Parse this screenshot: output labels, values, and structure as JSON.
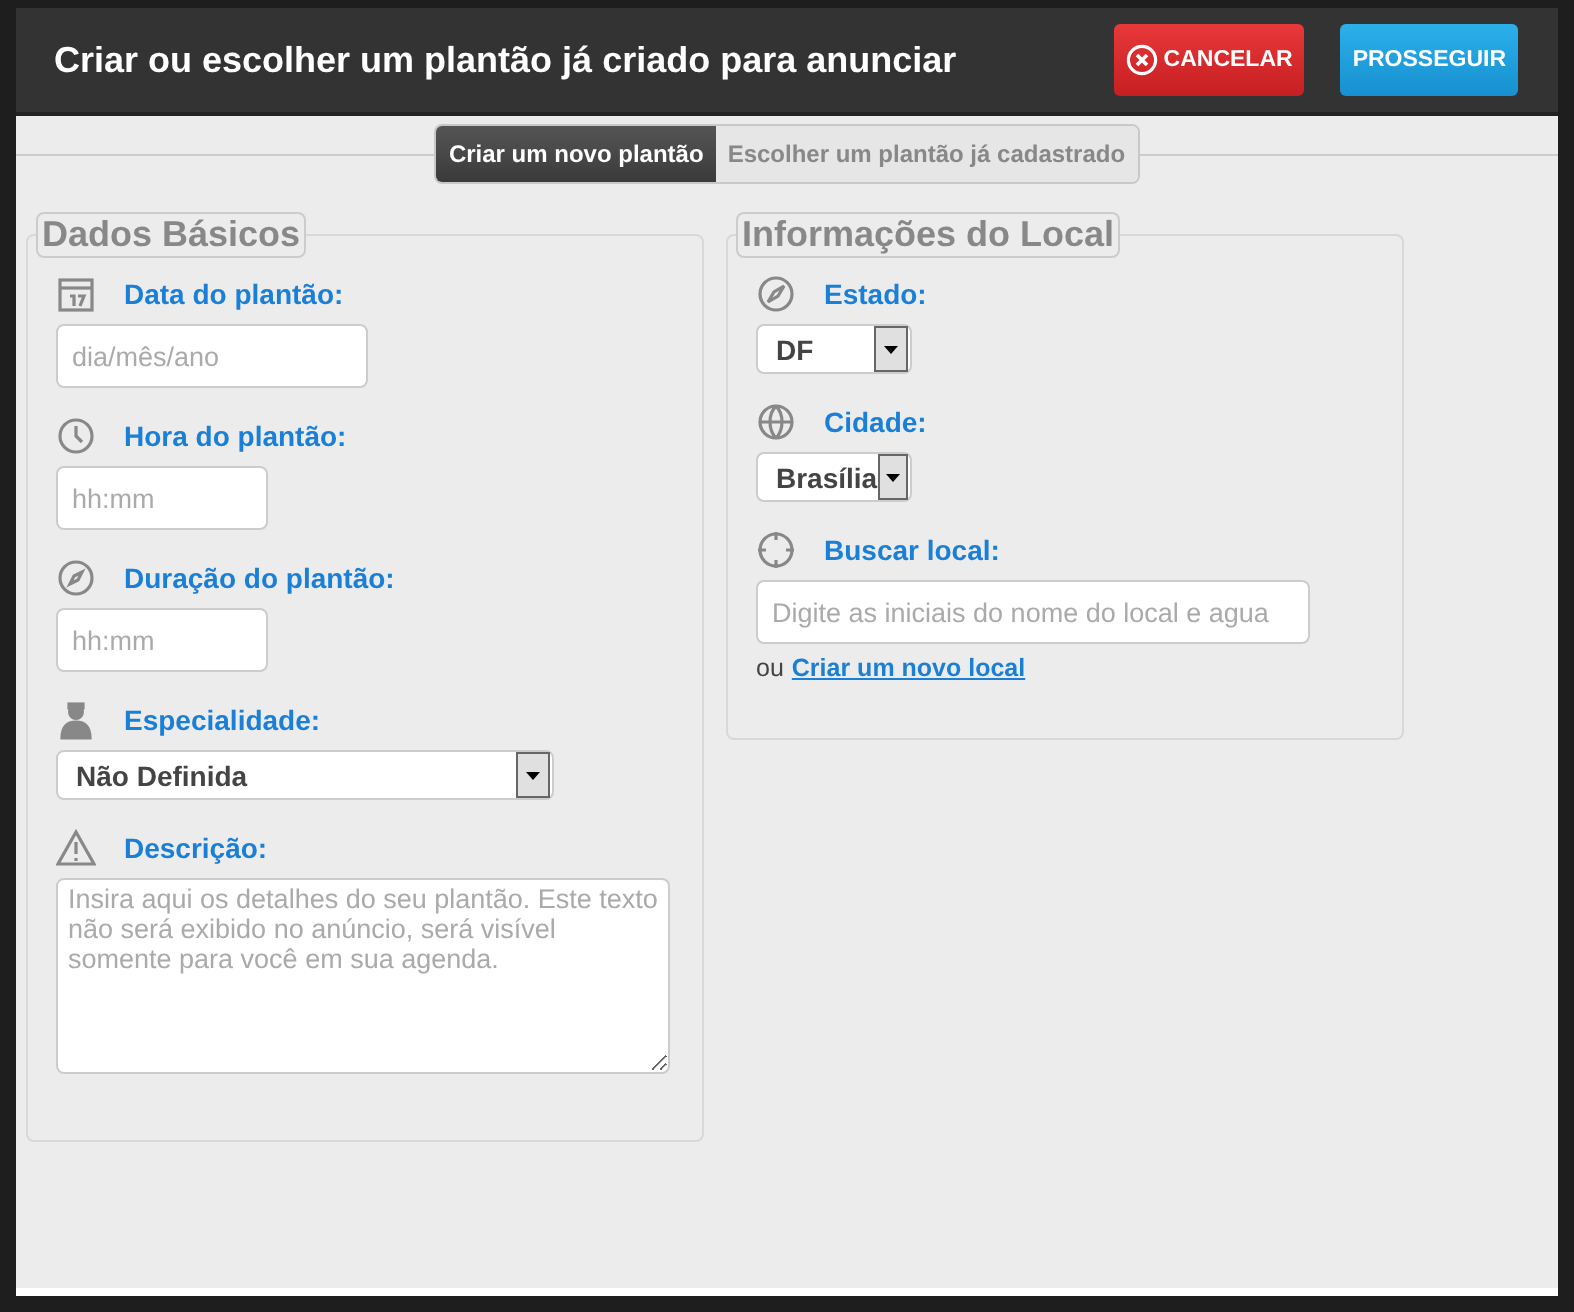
{
  "dialog": {
    "title": "Criar ou escolher um plantão já criado para anunciar",
    "buttons": [
      {
        "kind": "cancel",
        "label": "CANCELAR"
      },
      {
        "kind": "proceed",
        "label": "PROSSEGUIR"
      }
    ]
  },
  "tabs": [
    {
      "label": "Criar um novo plantão",
      "selected": true
    },
    {
      "label": "Escolher um plantão já cadastrado",
      "selected": false
    }
  ],
  "sections": [
    {
      "title": "Dados Básicos",
      "fields": [
        {
          "kind": "input",
          "label": "Data do plantão:",
          "placeholder": "dia/mês/ano"
        },
        {
          "kind": "input",
          "label": "Hora do plantão:",
          "placeholder": "hh:mm"
        },
        {
          "kind": "input",
          "label": "Duração do plantão:",
          "placeholder": "hh:mm"
        },
        {
          "kind": "select",
          "label": "Especialidade:",
          "value": "Não Definida"
        },
        {
          "kind": "textarea",
          "label": "Descrição:",
          "placeholder": "Insira aqui os detalhes do seu plantão. Este texto não será exibido no anúncio, será visível somente para você em sua agenda."
        }
      ]
    },
    {
      "title": "Informações do Local",
      "fields": [
        {
          "kind": "select",
          "label": "Estado:",
          "value": "DF"
        },
        {
          "kind": "select",
          "label": "Cidade:",
          "value": "Brasília"
        },
        {
          "kind": "input",
          "label": "Buscar local:",
          "placeholder": "Digite as iniciais do nome do local e agua",
          "note": "ou",
          "link": "Criar um novo local"
        }
      ]
    }
  ]
}
